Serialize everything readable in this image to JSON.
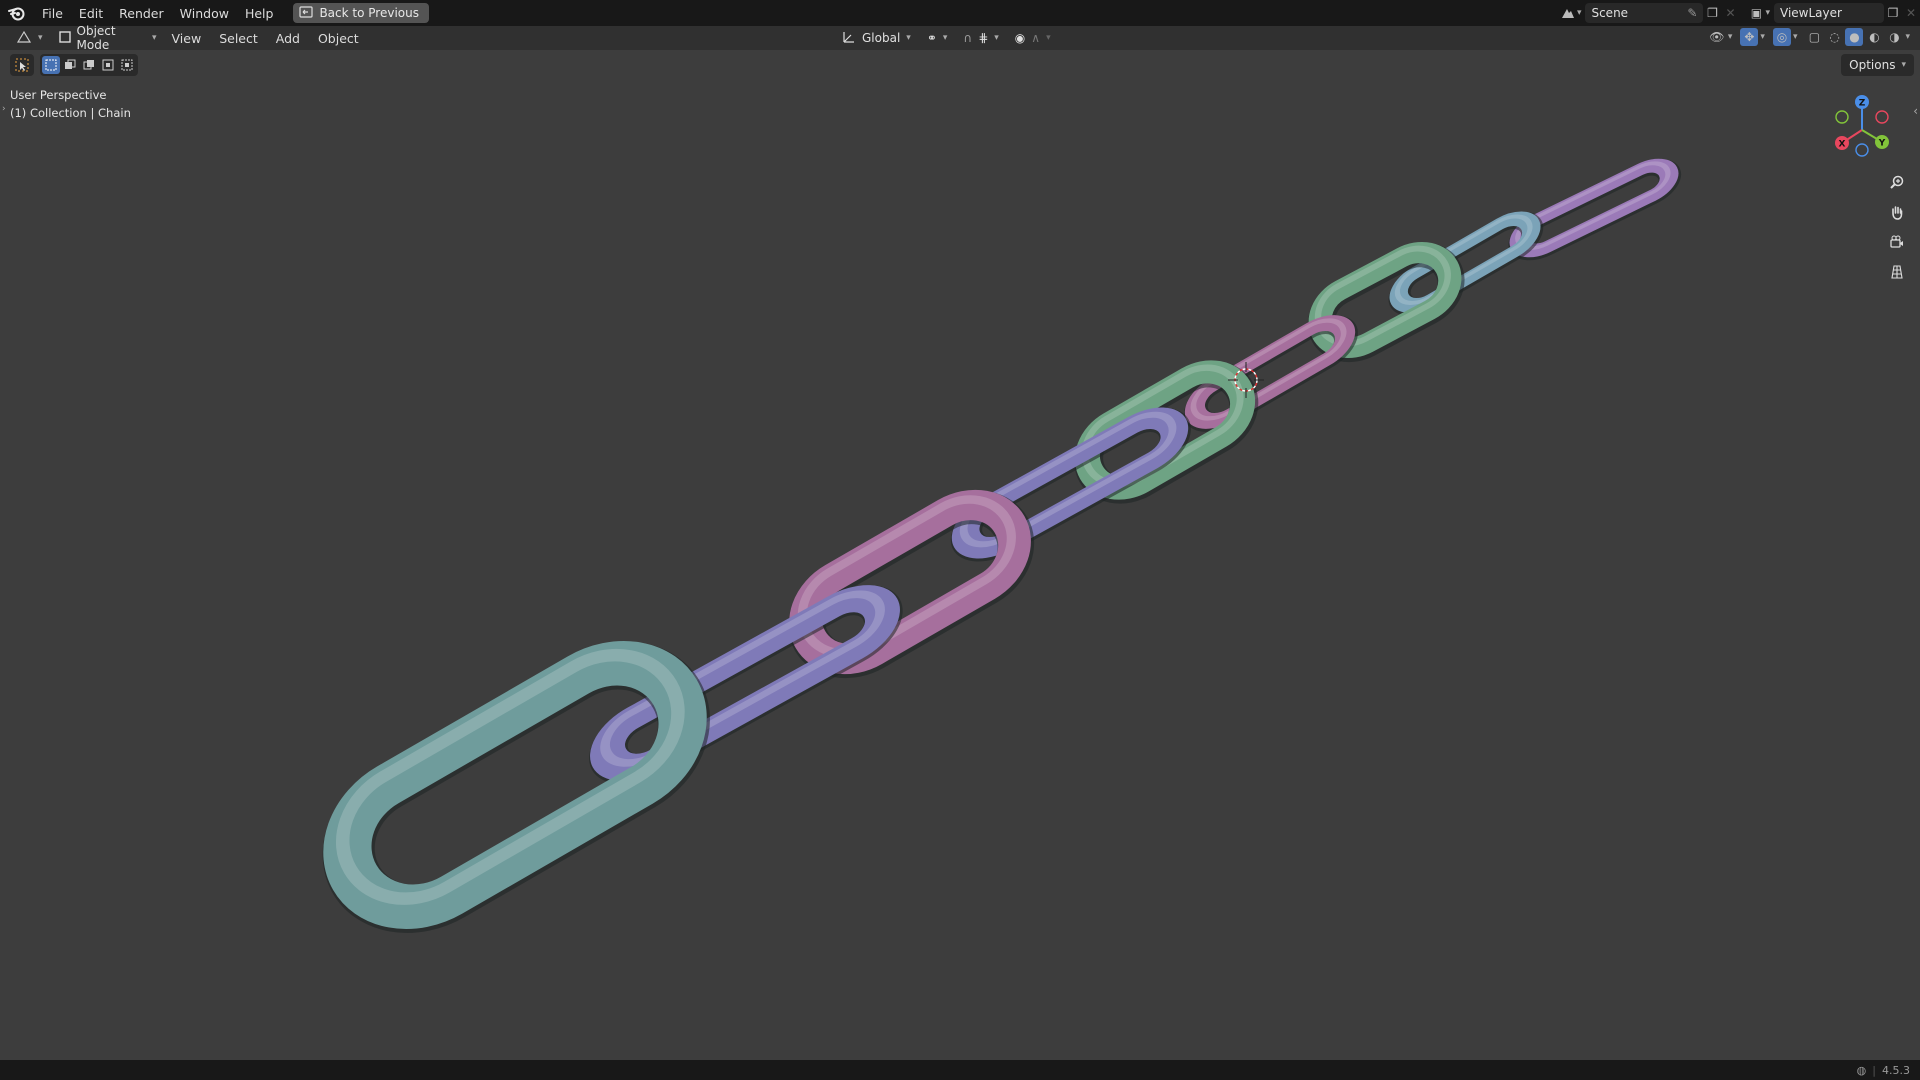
{
  "topbar": {
    "menus": [
      "File",
      "Edit",
      "Render",
      "Window",
      "Help"
    ],
    "back_button": "Back to Previous",
    "scene": "Scene",
    "view_layer": "ViewLayer"
  },
  "header": {
    "mode": "Object Mode",
    "menus": [
      "View",
      "Select",
      "Add",
      "Object"
    ],
    "orientation": "Global"
  },
  "viewport": {
    "options": "Options",
    "perspective": "User Perspective",
    "collection": "(1) Collection | Chain"
  },
  "gizmo": {
    "x": "X",
    "y": "Y",
    "z": "Z"
  },
  "status": {
    "version": "4.5.3"
  },
  "colors": {
    "teal": "#6f9c9c",
    "lavender": "#7f7ab8",
    "pink": "#a66f9d",
    "green": "#6ea384",
    "light_blue": "#7ba3b8",
    "purple": "#9b7ab8"
  }
}
